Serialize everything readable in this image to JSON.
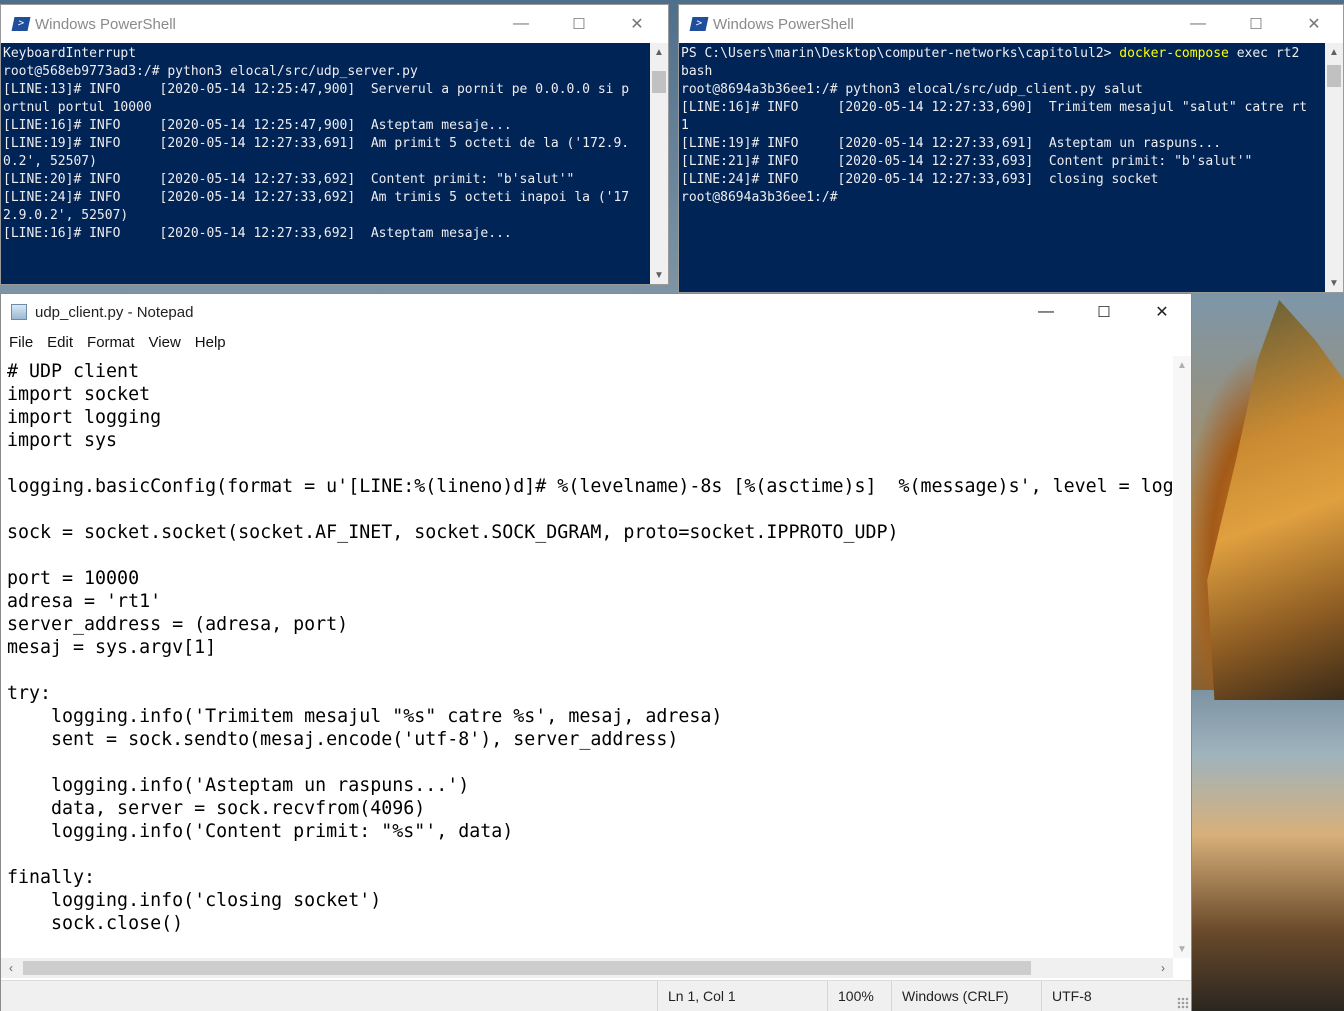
{
  "desktop": {
    "wallpaper": "coastal-rock-sunset"
  },
  "ps_left": {
    "title": "Windows PowerShell",
    "lines": [
      "KeyboardInterrupt",
      "root@568eb9773ad3:/# python3 elocal/src/udp_server.py",
      "[LINE:13]# INFO     [2020-05-14 12:25:47,900]  Serverul a pornit pe 0.0.0.0 si p",
      "ortnul portul 10000",
      "[LINE:16]# INFO     [2020-05-14 12:25:47,900]  Asteptam mesaje...",
      "[LINE:19]# INFO     [2020-05-14 12:27:33,691]  Am primit 5 octeti de la ('172.9.",
      "0.2', 52507)",
      "[LINE:20]# INFO     [2020-05-14 12:27:33,692]  Content primit: \"b'salut'\"",
      "[LINE:24]# INFO     [2020-05-14 12:27:33,692]  Am trimis 5 octeti inapoi la ('17",
      "2.9.0.2', 52507)",
      "[LINE:16]# INFO     [2020-05-14 12:27:33,692]  Asteptam mesaje..."
    ]
  },
  "ps_right": {
    "title": "Windows PowerShell",
    "prompt_prefix": "PS C:\\Users\\marin\\Desktop\\computer-networks\\capitolul2> ",
    "prompt_cmd": "docker-compose",
    "prompt_rest": " exec rt2",
    "lines": [
      "bash",
      "root@8694a3b36ee1:/# python3 elocal/src/udp_client.py salut",
      "[LINE:16]# INFO     [2020-05-14 12:27:33,690]  Trimitem mesajul \"salut\" catre rt",
      "1",
      "[LINE:19]# INFO     [2020-05-14 12:27:33,691]  Asteptam un raspuns...",
      "[LINE:21]# INFO     [2020-05-14 12:27:33,693]  Content primit: \"b'salut'\"",
      "[LINE:24]# INFO     [2020-05-14 12:27:33,693]  closing socket",
      "root@8694a3b36ee1:/#"
    ]
  },
  "notepad": {
    "title": "udp_client.py - Notepad",
    "menu": [
      "File",
      "Edit",
      "Format",
      "View",
      "Help"
    ],
    "code": "# UDP client\nimport socket\nimport logging\nimport sys\n\nlogging.basicConfig(format = u'[LINE:%(lineno)d]# %(levelname)-8s [%(asctime)s]  %(message)s', level = log\n\nsock = socket.socket(socket.AF_INET, socket.SOCK_DGRAM, proto=socket.IPPROTO_UDP)\n\nport = 10000\nadresa = 'rt1'\nserver_address = (adresa, port)\nmesaj = sys.argv[1]\n\ntry:\n    logging.info('Trimitem mesajul \"%s\" catre %s', mesaj, adresa)\n    sent = sock.sendto(mesaj.encode('utf-8'), server_address)\n\n    logging.info('Asteptam un raspuns...')\n    data, server = sock.recvfrom(4096)\n    logging.info('Content primit: \"%s\"', data)\n\nfinally:\n    logging.info('closing socket')\n    sock.close()",
    "status": {
      "position": "Ln 1, Col 1",
      "zoom": "100%",
      "line_endings": "Windows (CRLF)",
      "encoding": "UTF-8"
    }
  },
  "window_controls": {
    "minimize": "—",
    "maximize": "☐",
    "close": "✕"
  }
}
